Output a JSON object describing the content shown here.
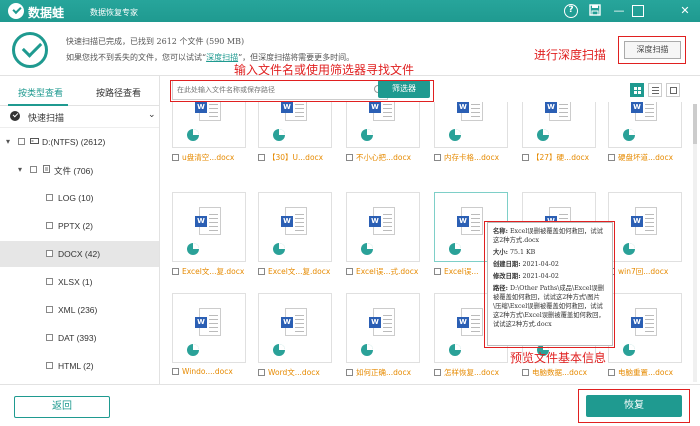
{
  "app": {
    "title": "数据蛙",
    "subtitle": "数据恢复专家"
  },
  "titlebar": {
    "help_icon": "?",
    "minimize_icon": "—",
    "close_icon": "✕"
  },
  "header": {
    "status_line": "快速扫描已完成，已找到 2612 个文件 (590 MB)",
    "hint_prefix": "如果您找不到丢失的文件，您可以试试“",
    "hint_link": "深度扫描",
    "hint_suffix": "”，但深度扫描将需要更多时间。",
    "deep_scan_label": "深度扫描",
    "deep_scan_annotation": "进行深度扫描"
  },
  "sidebar": {
    "tabs": [
      {
        "label": "按类型查看",
        "active": true
      },
      {
        "label": "按路径查看",
        "active": false
      }
    ],
    "quick_scan": "快速扫描",
    "tree": [
      {
        "label": "D:(NTFS) (2612)",
        "level": 0,
        "arrow": "▾",
        "icon": "drive-icon"
      },
      {
        "label": "文件 (706)",
        "level": 1,
        "arrow": "▾",
        "icon": "document-icon"
      },
      {
        "label": "LOG (10)",
        "level": 2
      },
      {
        "label": "PPTX (2)",
        "level": 2
      },
      {
        "label": "DOCX (42)",
        "level": 2,
        "selected": true
      },
      {
        "label": "XLSX (1)",
        "level": 2
      },
      {
        "label": "XML (236)",
        "level": 2
      },
      {
        "label": "DAT (393)",
        "level": 2
      },
      {
        "label": "HTML (2)",
        "level": 2
      }
    ]
  },
  "toolbar": {
    "search_placeholder": "在此处输入文件名称或保存路径",
    "filter_label": "筛选器",
    "search_annotation": "输入文件名或使用筛选器寻找文件"
  },
  "files": [
    [
      "u盘清空...docx",
      "【30】U...docx",
      "不小心把...docx",
      "内存卡格...docx",
      "【27】硬...docx",
      "硬盘坏道...docx"
    ],
    [
      "Excel文...复.docx",
      "Excel文...复.docx",
      "Excel误...式.docx",
      "Excel误...",
      "",
      "win7回...docx"
    ],
    [
      "Windo....docx",
      "Word文...docx",
      "如何正确...docx",
      "怎样恢复...docx",
      "电脑数据...docx",
      "电脑重置...docx"
    ]
  ],
  "tooltip": {
    "name_label": "名称:",
    "name_value": "Excel误删被覆盖如何救回，试试这2种方式.docx",
    "size_label": "大小:",
    "size_value": "75.1 KB",
    "created_label": "创建日期:",
    "created_value": "2021-04-02",
    "modified_label": "修改日期:",
    "modified_value": "2021-04-02",
    "path_label": "路径:",
    "path_value": "D:\\Other Paths\\成品\\Excel误删被覆盖如何救回，试试这2种方式\\图片\\压缩\\Excel误删被覆盖如何救回，试试这2种方式\\Excel误删被覆盖如何救回，试试这2种方式.docx",
    "annotation": "预览文件基本信息"
  },
  "footer": {
    "back_label": "返回",
    "recover_label": "恢复"
  },
  "colors": {
    "accent": "#1f9a90",
    "annotation": "#e02020",
    "filename": "#e68a00"
  }
}
